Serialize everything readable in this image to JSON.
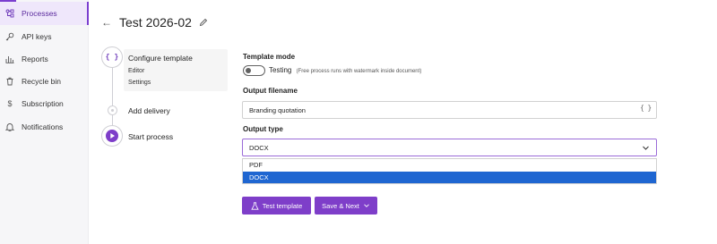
{
  "sidebar": {
    "items": [
      {
        "label": "Processes",
        "icon": "processes-icon",
        "active": true
      },
      {
        "label": "API keys",
        "icon": "key-icon"
      },
      {
        "label": "Reports",
        "icon": "chart-icon"
      },
      {
        "label": "Recycle bin",
        "icon": "trash-icon"
      },
      {
        "label": "Subscription",
        "icon": "dollar-icon"
      },
      {
        "label": "Notifications",
        "icon": "bell-icon"
      }
    ]
  },
  "header": {
    "back": "←",
    "title": "Test 2026-02"
  },
  "steps": {
    "step1": {
      "icon_text": "{ }",
      "title": "Configure template",
      "sub1": "Editor",
      "sub2": "Settings"
    },
    "step2": {
      "title": "Add delivery"
    },
    "step3": {
      "title": "Start process"
    }
  },
  "form": {
    "template_mode": {
      "label": "Template mode",
      "toggle_label": "Testing",
      "toggle_note": "(Free process runs with watermark inside document)",
      "enabled": false
    },
    "output_filename": {
      "label": "Output filename",
      "value": "Branding quotation",
      "icon_text": "{ }"
    },
    "output_type": {
      "label": "Output type",
      "value": "DOCX",
      "options": [
        "PDF",
        "DOCX"
      ],
      "selected": "DOCX"
    }
  },
  "buttons": {
    "test_template": "Test template",
    "save_next": "Save & Next"
  },
  "colors": {
    "accent": "#7e3ec9",
    "selected_option": "#1f66d1",
    "sidebar_active_bg": "#efe7fb"
  }
}
